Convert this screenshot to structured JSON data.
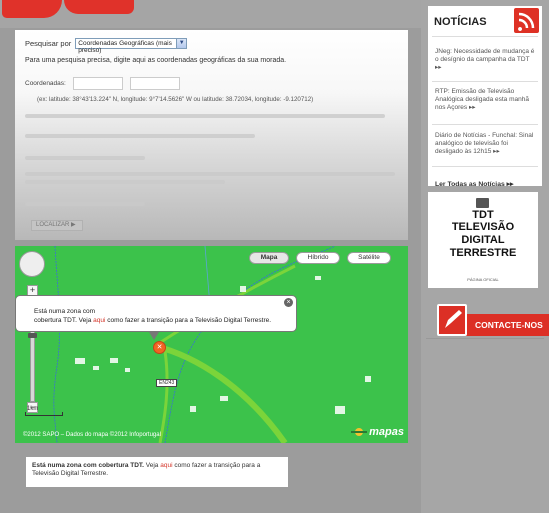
{
  "search": {
    "label": "Pesquisar por",
    "selected_option": "Coordenadas Geográficas (mais preciso)",
    "instruction": "Para uma pesquisa precisa, digite aqui as coordenadas geográficas da sua morada.",
    "coords_label": "Coordenadas:",
    "example": "(ex: latitude: 38°43'13.224\" N, longitude: 9°7'14.5626\" W ou latitude: 38.72034, longitude: -9.120712)",
    "locate_button": "LOCALIZAR"
  },
  "map": {
    "types": [
      "Mapa",
      "Híbrido",
      "Satélite"
    ],
    "popup_text_1": "Está numa zona com",
    "popup_text_2a": "cobertura TDT. Veja ",
    "popup_link": "aqui",
    "popup_text_2b": " como fazer a transição para a Televisão Digital Terrestre.",
    "road_label": "EN243",
    "scale": "1km",
    "copyright": "©2012 SAPO – Dados do mapa ©2012 Infoportugal",
    "logo": "mapas",
    "colors": {
      "land": "#3cc24b",
      "road": "#7bd43a",
      "river": "#3a6fd8",
      "marker": "#f26422"
    }
  },
  "result": {
    "bold_text": "Está numa zona com cobertura TDT.",
    "text_a": " Veja ",
    "link": "aqui",
    "text_b": " como fazer a transição para a Televisão Digital Terrestre."
  },
  "sidebar": {
    "news_title": "NOTÍCIAS",
    "news": [
      "JNeg: Necessidade de mudança é o desígnio da campanha da TDT ▸▸",
      "RTP: Emissão de Televisão Analógica desligada esta manhã nos Açores ▸▸",
      "Diário de Notícias - Funchal: Sinal analógico de televisão foi desligado às 12h15 ▸▸"
    ],
    "news_all": "Ler Todas as Notícias ▸▸",
    "tdt_lines": [
      "TDT",
      "TELEVISÃO",
      "DIGITAL",
      "TERRESTRE"
    ],
    "tdt_sub": "PÁGINA OFICIAL",
    "contact": "CONTACTE-NOS",
    "brand_color": "#dc2f25"
  }
}
